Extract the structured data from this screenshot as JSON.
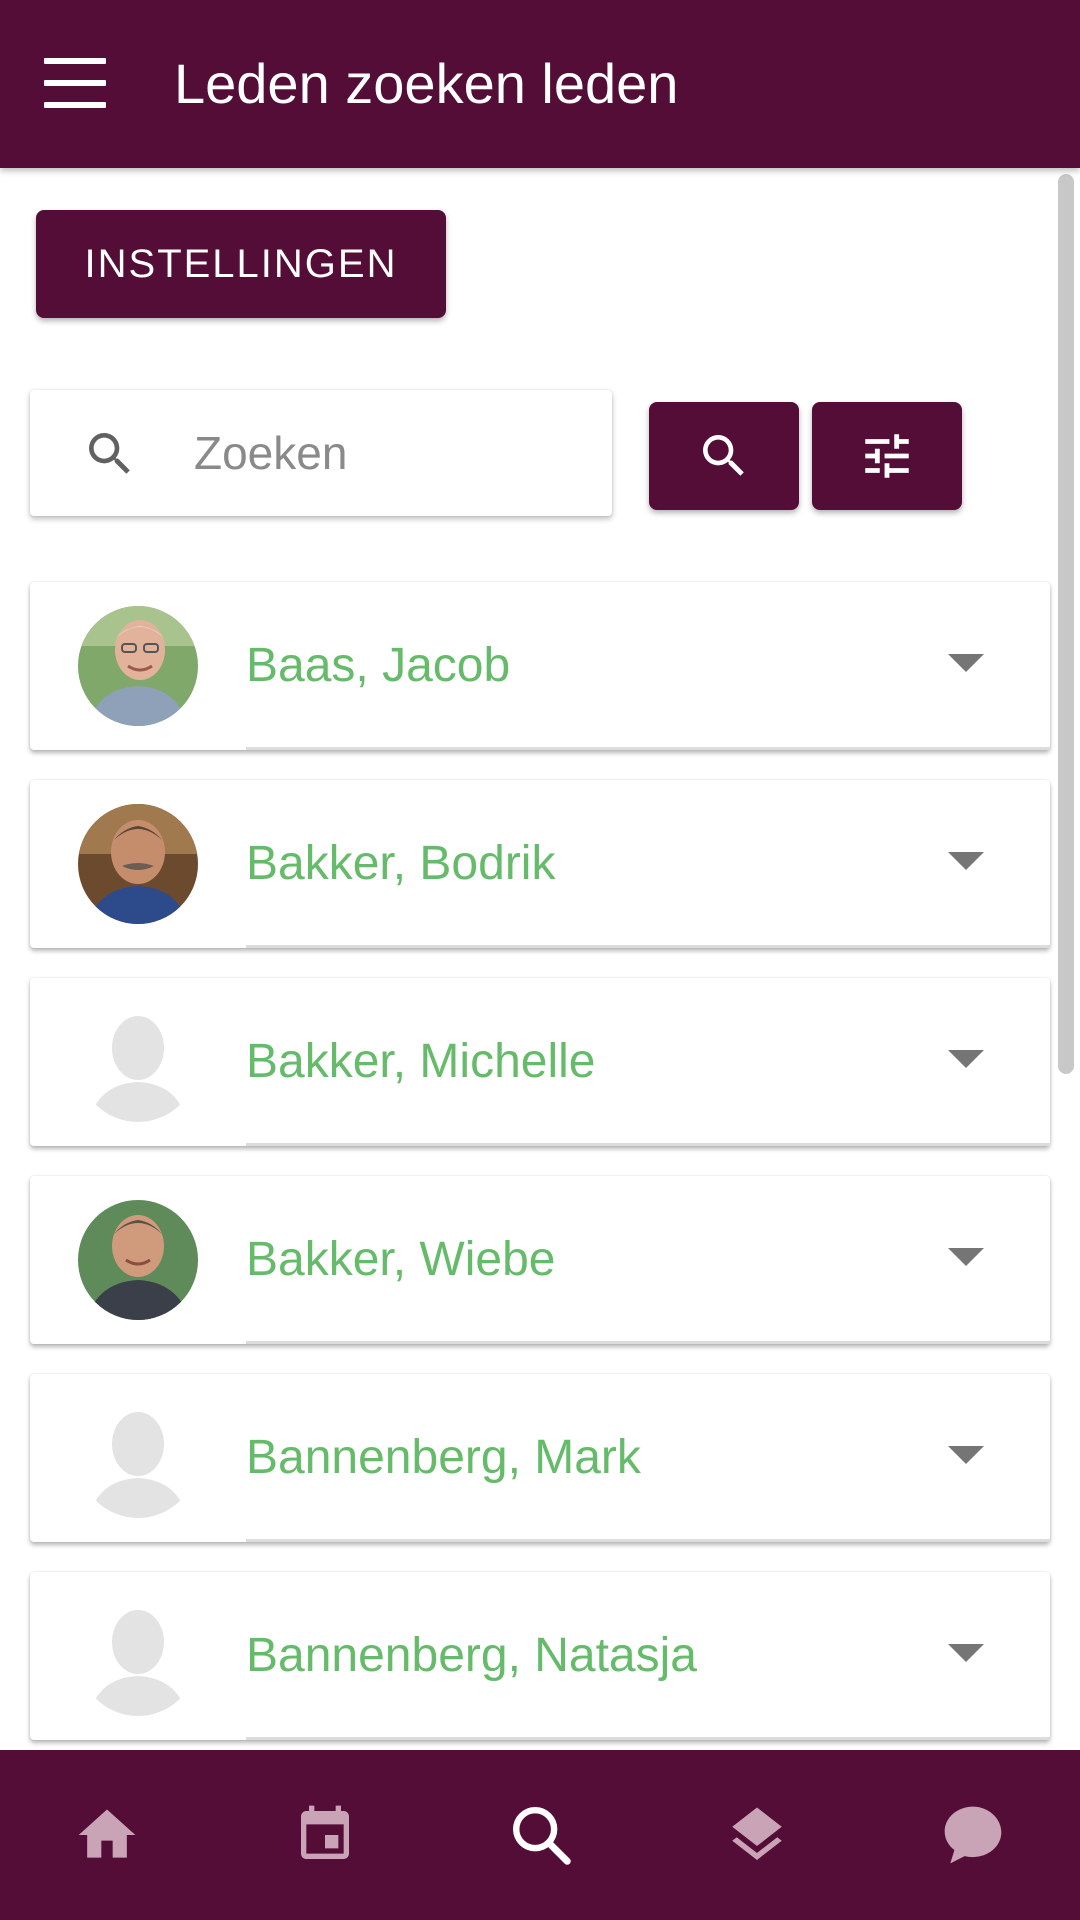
{
  "appbar": {
    "title": "Leden zoeken leden"
  },
  "settings_button": {
    "label": "INSTELLINGEN"
  },
  "search": {
    "placeholder": "Zoeken",
    "value": ""
  },
  "members": [
    {
      "name": "Baas, Jacob",
      "avatar": "photo-man-glasses"
    },
    {
      "name": "Bakker, Bodrik",
      "avatar": "photo-man-mustache"
    },
    {
      "name": "Bakker, Michelle",
      "avatar": "placeholder-silhouette"
    },
    {
      "name": "Bakker, Wiebe",
      "avatar": "photo-man-smiling"
    },
    {
      "name": "Bannenberg, Mark",
      "avatar": "placeholder-silhouette"
    },
    {
      "name": "Bannenberg, Natasja",
      "avatar": "placeholder-silhouette"
    }
  ],
  "bottom_nav": [
    {
      "icon": "home-icon",
      "active": false
    },
    {
      "icon": "calendar-icon",
      "active": false
    },
    {
      "icon": "search-icon",
      "active": true
    },
    {
      "icon": "layers-icon",
      "active": false
    },
    {
      "icon": "chat-icon",
      "active": false
    }
  ],
  "colors": {
    "primary": "#540d37",
    "member_name": "#66bb6a",
    "nav_inactive": "#c9a3b6",
    "nav_active": "#ffffff"
  }
}
